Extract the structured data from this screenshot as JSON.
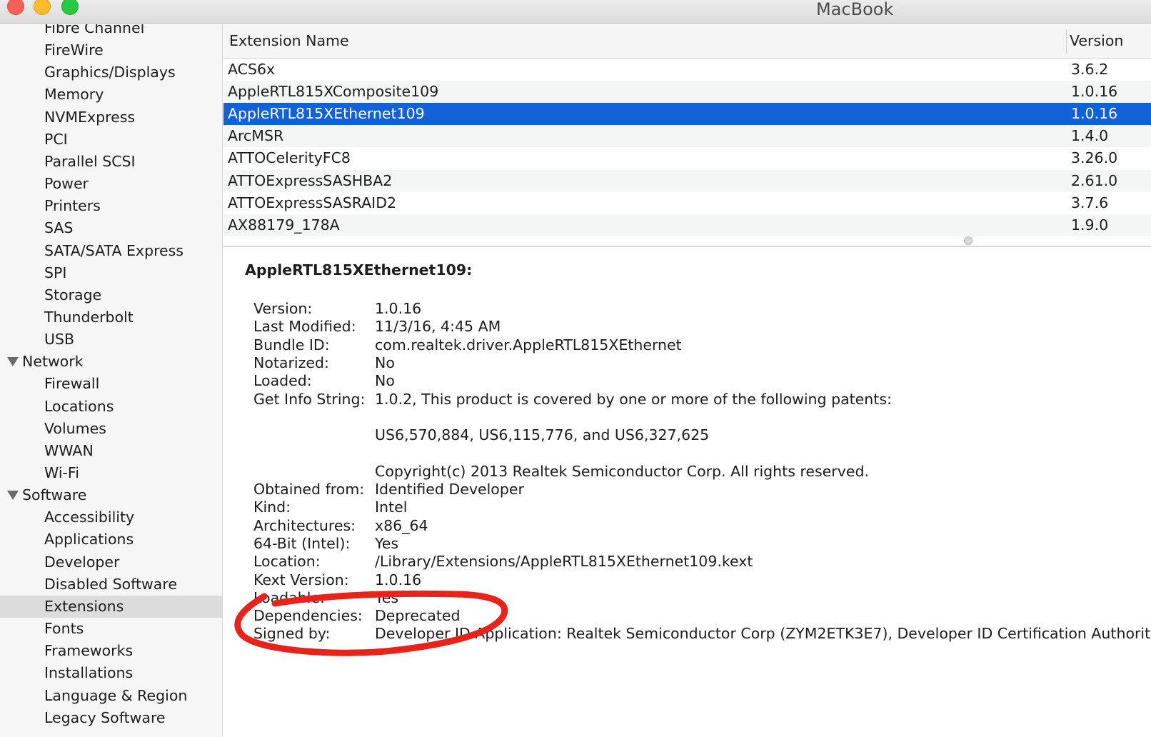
{
  "window": {
    "title": "MacBook"
  },
  "sidebar": {
    "items": [
      {
        "label": "Fibre Channel",
        "type": "item"
      },
      {
        "label": "FireWire",
        "type": "item"
      },
      {
        "label": "Graphics/Displays",
        "type": "item"
      },
      {
        "label": "Memory",
        "type": "item"
      },
      {
        "label": "NVMExpress",
        "type": "item"
      },
      {
        "label": "PCI",
        "type": "item"
      },
      {
        "label": "Parallel SCSI",
        "type": "item"
      },
      {
        "label": "Power",
        "type": "item"
      },
      {
        "label": "Printers",
        "type": "item"
      },
      {
        "label": "SAS",
        "type": "item"
      },
      {
        "label": "SATA/SATA Express",
        "type": "item"
      },
      {
        "label": "SPI",
        "type": "item"
      },
      {
        "label": "Storage",
        "type": "item"
      },
      {
        "label": "Thunderbolt",
        "type": "item"
      },
      {
        "label": "USB",
        "type": "item"
      },
      {
        "label": "Network",
        "type": "section"
      },
      {
        "label": "Firewall",
        "type": "item"
      },
      {
        "label": "Locations",
        "type": "item"
      },
      {
        "label": "Volumes",
        "type": "item"
      },
      {
        "label": "WWAN",
        "type": "item"
      },
      {
        "label": "Wi-Fi",
        "type": "item"
      },
      {
        "label": "Software",
        "type": "section"
      },
      {
        "label": "Accessibility",
        "type": "item"
      },
      {
        "label": "Applications",
        "type": "item"
      },
      {
        "label": "Developer",
        "type": "item"
      },
      {
        "label": "Disabled Software",
        "type": "item"
      },
      {
        "label": "Extensions",
        "type": "item",
        "selected": true
      },
      {
        "label": "Fonts",
        "type": "item"
      },
      {
        "label": "Frameworks",
        "type": "item"
      },
      {
        "label": "Installations",
        "type": "item"
      },
      {
        "label": "Language & Region",
        "type": "item"
      },
      {
        "label": "Legacy Software",
        "type": "item"
      }
    ]
  },
  "table": {
    "columns": {
      "name": "Extension Name",
      "version": "Version"
    },
    "rows": [
      {
        "name": "ACS6x",
        "version": "3.6.2"
      },
      {
        "name": "AppleRTL815XComposite109",
        "version": "1.0.16"
      },
      {
        "name": "AppleRTL815XEthernet109",
        "version": "1.0.16",
        "selected": true
      },
      {
        "name": "ArcMSR",
        "version": "1.4.0"
      },
      {
        "name": "ATTOCelerityFC8",
        "version": "3.26.0"
      },
      {
        "name": "ATTOExpressSASHBA2",
        "version": "2.61.0"
      },
      {
        "name": "ATTOExpressSASRAID2",
        "version": "3.7.6"
      },
      {
        "name": "AX88179_178A",
        "version": "1.9.0"
      }
    ]
  },
  "detail": {
    "title": "AppleRTL815XEthernet109:",
    "fields": [
      {
        "key": "Version:",
        "value": "1.0.16"
      },
      {
        "key": "Last Modified:",
        "value": "11/3/16, 4:45 AM"
      },
      {
        "key": "Bundle ID:",
        "value": "com.realtek.driver.AppleRTL815XEthernet"
      },
      {
        "key": "Notarized:",
        "value": "No"
      },
      {
        "key": "Loaded:",
        "value": "No"
      },
      {
        "key": "Get Info String:",
        "value": "1.0.2, This product is covered by one or more of the following patents:"
      },
      {
        "key": "",
        "value": ""
      },
      {
        "key": "",
        "value": "US6,570,884, US6,115,776, and US6,327,625"
      },
      {
        "key": "",
        "value": ""
      },
      {
        "key": "",
        "value": "Copyright(c) 2013 Realtek Semiconductor Corp. All rights reserved."
      },
      {
        "key": "Obtained from:",
        "value": "Identified Developer"
      },
      {
        "key": "Kind:",
        "value": "Intel"
      },
      {
        "key": "Architectures:",
        "value": "x86_64"
      },
      {
        "key": "64-Bit (Intel):",
        "value": "Yes"
      },
      {
        "key": "Location:",
        "value": "/Library/Extensions/AppleRTL815XEthernet109.kext"
      },
      {
        "key": "Kext Version:",
        "value": "1.0.16"
      },
      {
        "key": "Loadable:",
        "value": "Yes"
      },
      {
        "key": "Dependencies:",
        "value": "Deprecated"
      },
      {
        "key": "Signed by:",
        "value": "Developer ID Application: Realtek Semiconductor Corp (ZYM2ETK3E7), Developer ID Certification Authority, Apple Root CA"
      }
    ]
  },
  "colors": {
    "selection": "#1261d9",
    "annotation": "#e8231c"
  }
}
